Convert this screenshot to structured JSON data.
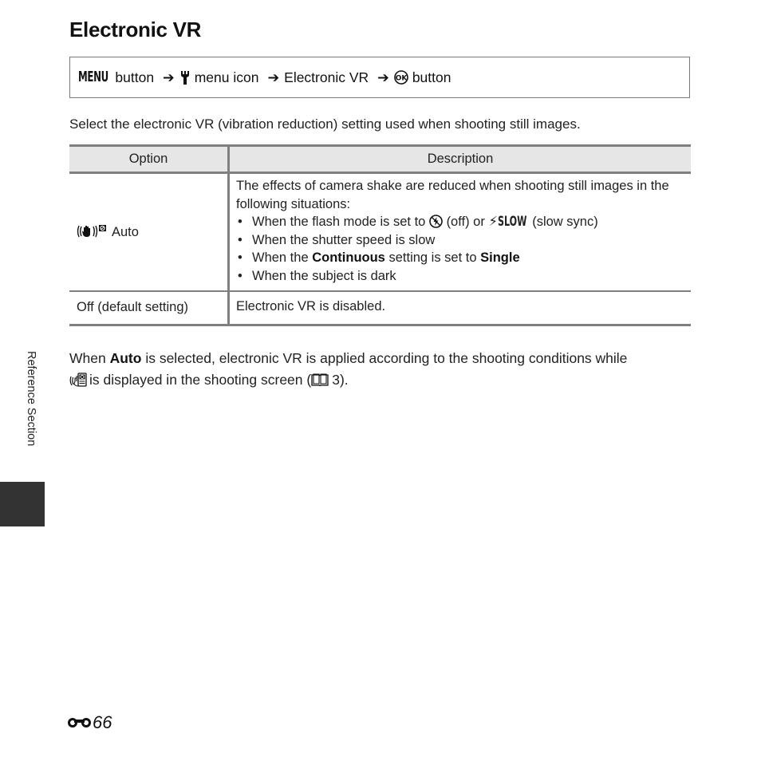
{
  "page": {
    "title": "Electronic VR",
    "side_label": "Reference Section",
    "page_number": "66",
    "page_prefix_icon": "reference-section-icon"
  },
  "nav_path": {
    "menu_label": "MENU",
    "button_word": "button",
    "arrow": "➔",
    "menu_icon_label": "menu icon",
    "item": "Electronic VR",
    "ok_button_word": "button",
    "icons": [
      "menu-button-icon",
      "wrench-icon",
      "ok-button-icon"
    ]
  },
  "intro": "Select the electronic VR (vibration reduction) setting used when shooting still images.",
  "table": {
    "headers": [
      "Option",
      "Description"
    ],
    "rows": [
      {
        "option": "Auto",
        "option_icon": "electronic-vr-auto-icon",
        "description_intro": "The effects of camera shake are reduced when shooting still images in the following situations:",
        "bullets": {
          "b1_a": "When the flash mode is set to",
          "b1_b": "(off) or",
          "b1_slow": "SLOW",
          "b1_c": "(slow sync)",
          "b2": "When the shutter speed is slow",
          "b3_a": "When the",
          "b3_bold1": "Continuous",
          "b3_b": "setting is set to",
          "b3_bold2": "Single",
          "b4": "When the subject is dark"
        }
      },
      {
        "option": "Off (default setting)",
        "description": "Electronic VR is disabled."
      }
    ]
  },
  "note": {
    "part1": "When",
    "bold": "Auto",
    "part2": "is selected, electronic VR is applied according to the shooting conditions while",
    "part3": "is displayed in the shooting screen (",
    "ref_page": "3).",
    "icons": [
      "electronic-vr-hand-icon",
      "book-reference-icon"
    ]
  },
  "colors": {
    "rule_gray": "#808080",
    "header_bg": "#e6e6e6",
    "side_tab": "#333333"
  }
}
